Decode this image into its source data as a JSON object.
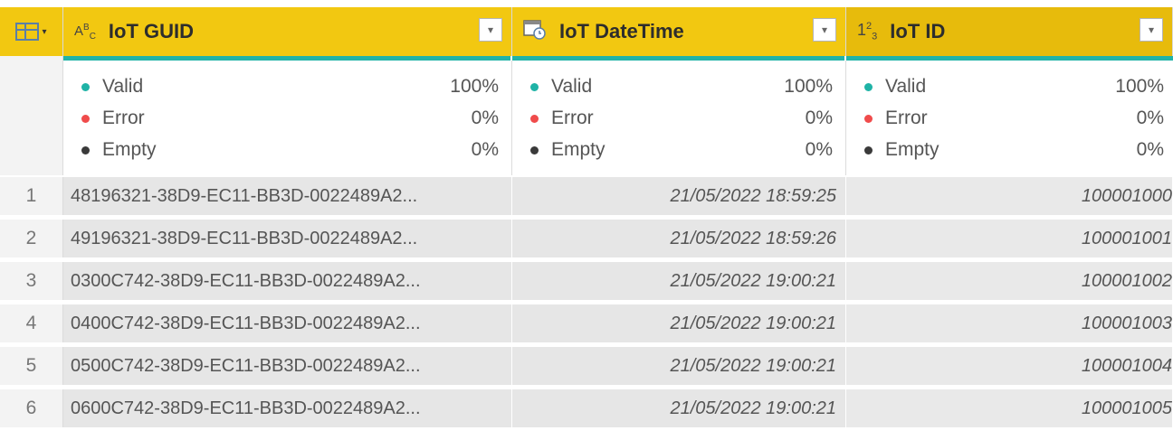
{
  "columns": [
    {
      "type_icon": "text-type-icon",
      "type_label": "ABC",
      "name": "IoT GUID"
    },
    {
      "type_icon": "datetime-type-icon",
      "type_label": "",
      "name": "IoT DateTime"
    },
    {
      "type_icon": "number-type-icon",
      "type_label": "123",
      "name": "IoT ID"
    }
  ],
  "quality": [
    {
      "valid_label": "Valid",
      "valid_pct": "100%",
      "error_label": "Error",
      "error_pct": "0%",
      "empty_label": "Empty",
      "empty_pct": "0%"
    },
    {
      "valid_label": "Valid",
      "valid_pct": "100%",
      "error_label": "Error",
      "error_pct": "0%",
      "empty_label": "Empty",
      "empty_pct": "0%"
    },
    {
      "valid_label": "Valid",
      "valid_pct": "100%",
      "error_label": "Error",
      "error_pct": "0%",
      "empty_label": "Empty",
      "empty_pct": "0%"
    }
  ],
  "rows": [
    {
      "num": "1",
      "guid": "48196321-38D9-EC11-BB3D-0022489A2...",
      "datetime": "21/05/2022 18:59:25",
      "id": "100001000"
    },
    {
      "num": "2",
      "guid": "49196321-38D9-EC11-BB3D-0022489A2...",
      "datetime": "21/05/2022 18:59:26",
      "id": "100001001"
    },
    {
      "num": "3",
      "guid": "0300C742-38D9-EC11-BB3D-0022489A2...",
      "datetime": "21/05/2022 19:00:21",
      "id": "100001002"
    },
    {
      "num": "4",
      "guid": "0400C742-38D9-EC11-BB3D-0022489A2...",
      "datetime": "21/05/2022 19:00:21",
      "id": "100001003"
    },
    {
      "num": "5",
      "guid": "0500C742-38D9-EC11-BB3D-0022489A2...",
      "datetime": "21/05/2022 19:00:21",
      "id": "100001004"
    },
    {
      "num": "6",
      "guid": "0600C742-38D9-EC11-BB3D-0022489A2...",
      "datetime": "21/05/2022 19:00:21",
      "id": "100001005"
    }
  ],
  "colors": {
    "header": "#f2c811",
    "header_selected": "#e7bb0c",
    "quality_bar": "#21b3a8",
    "valid": "#1fb3a6",
    "error": "#f04b4b",
    "empty": "#3a3a3a"
  }
}
